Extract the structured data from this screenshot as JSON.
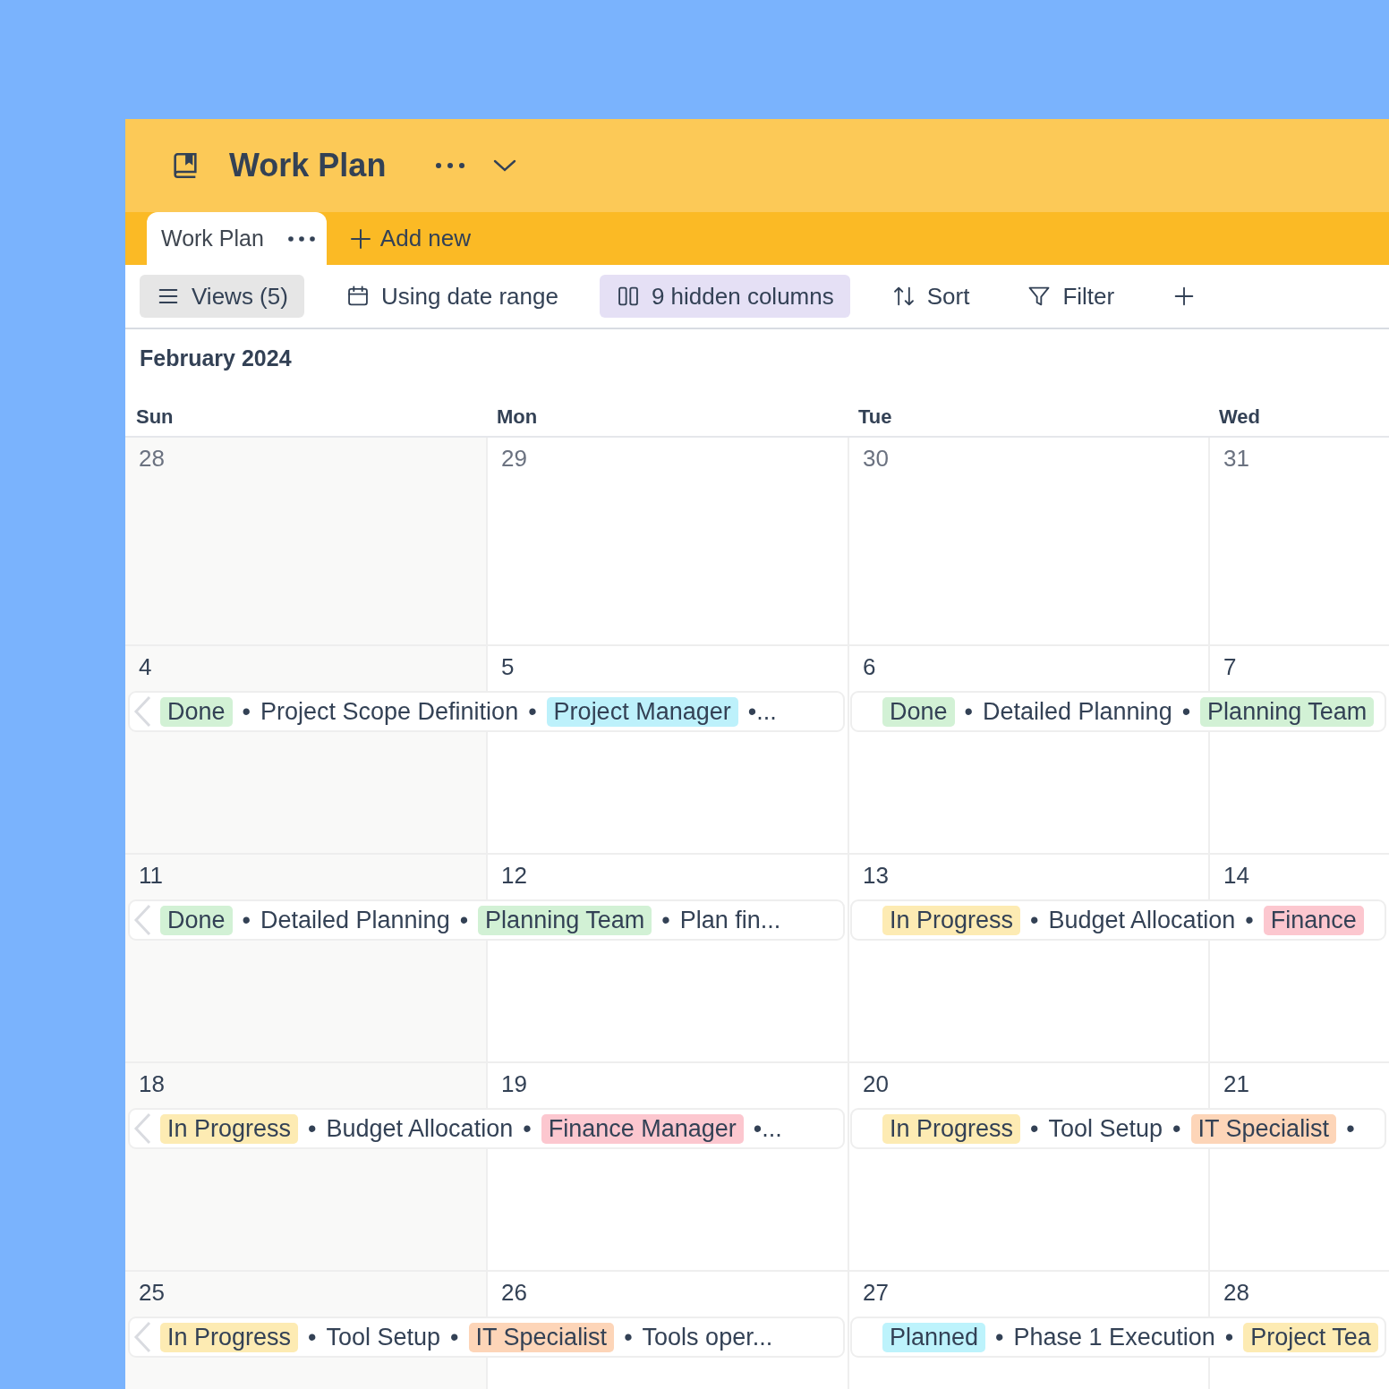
{
  "header": {
    "title": "Work Plan"
  },
  "tabs": [
    {
      "label": "Work Plan",
      "selected": true,
      "has_menu": true
    }
  ],
  "add_tab": {
    "label": "Add new"
  },
  "toolbar": [
    {
      "kind": "views",
      "label": "Views (5)",
      "active": true
    },
    {
      "kind": "date",
      "label": "Using date range",
      "active": false
    },
    {
      "kind": "columns",
      "label": "9 hidden columns",
      "active": true
    },
    {
      "kind": "sort",
      "label": "Sort",
      "active": false
    },
    {
      "kind": "filter",
      "label": "Filter",
      "active": false
    },
    {
      "kind": "add",
      "active": false
    }
  ],
  "calendar": {
    "month": "February 2024",
    "columns": [
      {
        "label": "Sun"
      },
      {
        "label": "Mon"
      },
      {
        "label": "Tue"
      },
      {
        "label": "Wed"
      }
    ],
    "weeks": [
      {
        "days": [
          {
            "date": "28",
            "muted": true
          },
          {
            "date": "29",
            "muted": true
          },
          {
            "date": "30",
            "muted": true
          },
          {
            "date": "31",
            "muted": true
          }
        ]
      },
      {
        "days": [
          {
            "date": "4",
            "muted": false
          },
          {
            "date": "5",
            "muted": false
          },
          {
            "date": "6",
            "muted": false
          },
          {
            "date": "7",
            "muted": false
          }
        ],
        "events": [
          {
            "continued": true,
            "separator": "•",
            "segments": [
              {
                "kind": "tag",
                "text": "Done",
                "color": "#d2f1d5"
              },
              {
                "kind": "text",
                "text": "Project Scope Definition"
              },
              {
                "kind": "tag",
                "text": "Project Manager",
                "color": "#bdf1fb"
              }
            ],
            "trailing": "•..."
          },
          {
            "continued": false,
            "separator": "•",
            "segments": [
              {
                "kind": "tag",
                "text": "Done",
                "color": "#d2f1d5"
              },
              {
                "kind": "text",
                "text": "Detailed Planning"
              },
              {
                "kind": "tag",
                "text": "Planning Team",
                "color": "#d2f1d5"
              }
            ]
          }
        ]
      },
      {
        "days": [
          {
            "date": "11",
            "muted": false
          },
          {
            "date": "12",
            "muted": false
          },
          {
            "date": "13",
            "muted": false
          },
          {
            "date": "14",
            "muted": false
          }
        ],
        "events": [
          {
            "continued": true,
            "separator": "•",
            "segments": [
              {
                "kind": "tag",
                "text": "Done",
                "color": "#d2f1d5"
              },
              {
                "kind": "text",
                "text": "Detailed Planning"
              },
              {
                "kind": "tag",
                "text": "Planning Team",
                "color": "#d2f1d5"
              },
              {
                "kind": "text",
                "text": "Plan fin..."
              }
            ]
          },
          {
            "continued": false,
            "separator": "•",
            "segments": [
              {
                "kind": "tag",
                "text": "In Progress",
                "color": "#fdebb3"
              },
              {
                "kind": "text",
                "text": "Budget Allocation"
              },
              {
                "kind": "tag",
                "text": "Finance",
                "color": "#fcc7cf"
              }
            ]
          }
        ]
      },
      {
        "days": [
          {
            "date": "18",
            "muted": false
          },
          {
            "date": "19",
            "muted": false
          },
          {
            "date": "20",
            "muted": false
          },
          {
            "date": "21",
            "muted": false
          }
        ],
        "events": [
          {
            "continued": true,
            "separator": "•",
            "segments": [
              {
                "kind": "tag",
                "text": "In Progress",
                "color": "#fdebb3"
              },
              {
                "kind": "text",
                "text": "Budget Allocation"
              },
              {
                "kind": "tag",
                "text": "Finance Manager",
                "color": "#fcc7cf"
              }
            ],
            "trailing": "•..."
          },
          {
            "continued": false,
            "separator": "•",
            "segments": [
              {
                "kind": "tag",
                "text": "In Progress",
                "color": "#fdebb3"
              },
              {
                "kind": "text",
                "text": "Tool Setup"
              },
              {
                "kind": "tag",
                "text": "IT Specialist",
                "color": "#fdd5b8"
              }
            ],
            "trailing": "•"
          }
        ]
      },
      {
        "days": [
          {
            "date": "25",
            "muted": false
          },
          {
            "date": "26",
            "muted": false
          },
          {
            "date": "27",
            "muted": false
          },
          {
            "date": "28",
            "muted": false
          }
        ],
        "events": [
          {
            "continued": true,
            "separator": "•",
            "segments": [
              {
                "kind": "tag",
                "text": "In Progress",
                "color": "#fdebb3"
              },
              {
                "kind": "text",
                "text": "Tool Setup"
              },
              {
                "kind": "tag",
                "text": "IT Specialist",
                "color": "#fdd5b8"
              },
              {
                "kind": "text",
                "text": "Tools oper..."
              }
            ]
          },
          {
            "continued": false,
            "separator": "•",
            "segments": [
              {
                "kind": "tag",
                "text": "Planned",
                "color": "#bdf3fc"
              },
              {
                "kind": "text",
                "text": "Phase 1 Execution"
              },
              {
                "kind": "tag",
                "text": "Project Tea",
                "color": "#fdebb3"
              }
            ]
          }
        ]
      }
    ]
  }
}
